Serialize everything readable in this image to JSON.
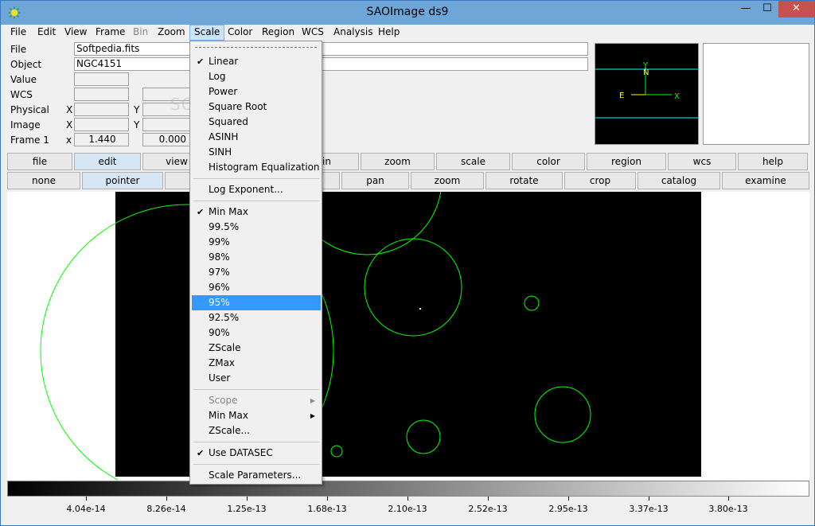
{
  "window": {
    "title": "SAOImage ds9",
    "minimize_icon": "—",
    "maximize_icon": "☐",
    "close_icon": "✕"
  },
  "menubar": [
    {
      "label": "File",
      "state": "normal"
    },
    {
      "label": "Edit",
      "state": "normal"
    },
    {
      "label": "View",
      "state": "normal"
    },
    {
      "label": "Frame",
      "state": "normal"
    },
    {
      "label": "Bin",
      "state": "disabled"
    },
    {
      "label": "Zoom",
      "state": "normal"
    },
    {
      "label": "Scale",
      "state": "active"
    },
    {
      "label": "Color",
      "state": "normal"
    },
    {
      "label": "Region",
      "state": "normal"
    },
    {
      "label": "WCS",
      "state": "normal"
    },
    {
      "label": "Analysis",
      "state": "normal"
    },
    {
      "label": "Help",
      "state": "normal"
    }
  ],
  "info": {
    "file_label": "File",
    "file_value": "Softpedia.fits",
    "object_label": "Object",
    "object_value": "NGC4151",
    "value_label": "Value",
    "wcs_label": "WCS",
    "physical_label": "Physical",
    "physical_x": "X",
    "physical_y": "Y",
    "image_label": "Image",
    "image_x": "X",
    "image_y": "Y",
    "frame_label": "Frame 1",
    "frame_x": "x",
    "frame_x_value": "1.440",
    "frame_y_value": "0.000"
  },
  "watermark": "SOFTPEDIA",
  "buttonbar_top": [
    "file",
    "edit",
    "view",
    "bin",
    "zoom",
    "scale",
    "color",
    "region",
    "wcs",
    "help"
  ],
  "buttonbar_bottom": [
    "none",
    "pointer",
    "pan",
    "zoom",
    "rotate",
    "crop",
    "catalog",
    "examine"
  ],
  "panner": {
    "north_label": "N",
    "y_label": "Y",
    "east_label": "E",
    "x_label": "X"
  },
  "colorbar": {
    "tick_labels": [
      "4.04e-14",
      "8.26e-14",
      "1.25e-13",
      "1.68e-13",
      "2.10e-13",
      "2.52e-13",
      "2.95e-13",
      "3.37e-13",
      "3.80e-13"
    ]
  },
  "scale_menu": {
    "items": [
      {
        "label": "Linear",
        "checked": true
      },
      {
        "label": "Log"
      },
      {
        "label": "Power"
      },
      {
        "label": "Square Root"
      },
      {
        "label": "Squared"
      },
      {
        "label": "ASINH"
      },
      {
        "label": "SINH"
      },
      {
        "label": "Histogram Equalization"
      },
      {
        "separator": true
      },
      {
        "label": "Log Exponent..."
      },
      {
        "separator": true
      },
      {
        "label": "Min Max",
        "checked": true
      },
      {
        "label": "99.5%"
      },
      {
        "label": "99%"
      },
      {
        "label": "98%"
      },
      {
        "label": "97%"
      },
      {
        "label": "96%"
      },
      {
        "label": "95%",
        "highlighted": true
      },
      {
        "label": "92.5%"
      },
      {
        "label": "90%"
      },
      {
        "label": "ZScale"
      },
      {
        "label": "ZMax"
      },
      {
        "label": "User"
      },
      {
        "separator": true
      },
      {
        "label": "Scope",
        "disabled": true,
        "submenu": true
      },
      {
        "label": "Min Max",
        "submenu": true
      },
      {
        "label": "ZScale..."
      },
      {
        "separator": true
      },
      {
        "label": "Use DATASEC",
        "checked": true
      },
      {
        "separator": true
      },
      {
        "label": "Scale Parameters..."
      }
    ],
    "check_glyph": "✔",
    "submenu_glyph": "▶"
  },
  "colors": {
    "region": "#00ff00",
    "panner_line": "#00ffff",
    "panner_compass": "#ffff00",
    "highlight": "#3399ff"
  }
}
